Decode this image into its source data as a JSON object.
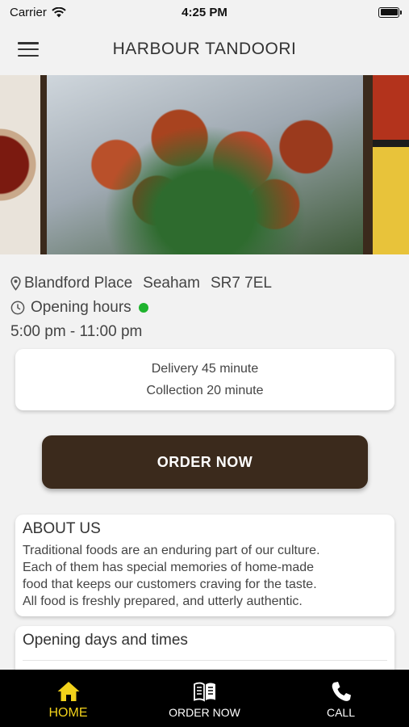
{
  "status_bar": {
    "carrier": "Carrier",
    "time": "4:25 PM",
    "icons": [
      "wifi-icon",
      "battery-icon"
    ]
  },
  "header": {
    "title": "HARBOUR TANDOORI",
    "menu_icon": "hamburger-menu-icon"
  },
  "carousel": {
    "slides": [
      "sauce-dish-image",
      "tandoori-chicken-image",
      "rice-curry-image"
    ]
  },
  "info": {
    "address_parts": [
      "Blandford Place",
      "Seaham",
      "SR7 7EL"
    ],
    "opening_hours_label": "Opening hours",
    "open_status_color": "#1fb32e",
    "hours_range": "5:00 pm - 11:00 pm"
  },
  "service_times": {
    "delivery": "Delivery 45 minute",
    "collection": "Collection 20 minute"
  },
  "order_button": {
    "label": "ORDER NOW",
    "color": "#3b2a1c"
  },
  "about": {
    "title": "ABOUT US",
    "lines": [
      "Traditional foods are an enduring part of our culture.",
      "Each of them has special memories of home-made",
      "food that keeps our customers craving for the taste.",
      "All food is freshly prepared, and utterly authentic."
    ]
  },
  "opening_days": {
    "title": "Opening days and times"
  },
  "tab_bar": {
    "tabs": [
      {
        "label": "HOME",
        "icon": "home-icon",
        "active": true
      },
      {
        "label": "ORDER NOW",
        "icon": "menu-book-icon",
        "active": false
      },
      {
        "label": "CALL",
        "icon": "phone-icon",
        "active": false
      }
    ],
    "active_color": "#f2d21b"
  }
}
